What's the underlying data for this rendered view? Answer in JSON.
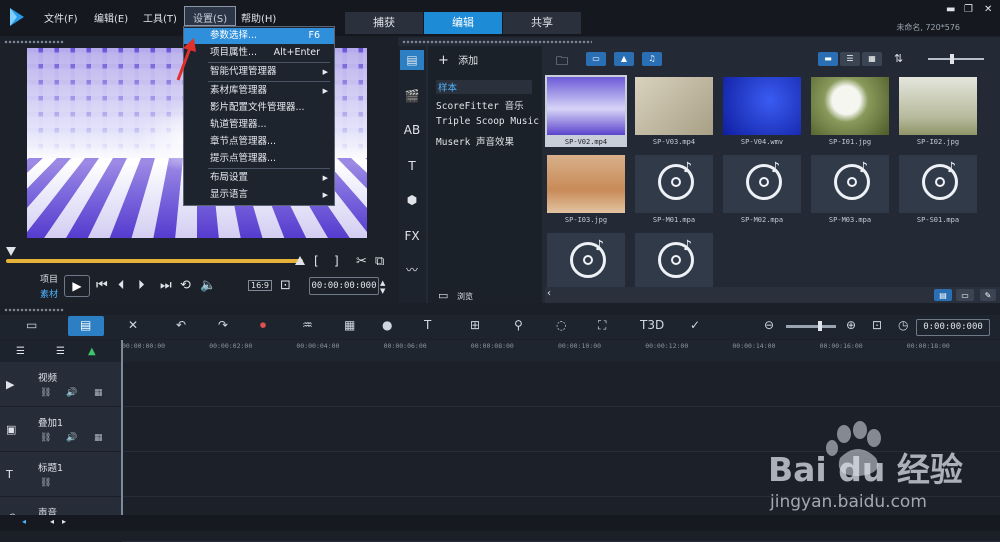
{
  "menubar": {
    "file": "文件(F)",
    "edit": "编辑(E)",
    "tools": "工具(T)",
    "settings": "设置(S)",
    "help": "帮助(H)"
  },
  "mode_tabs": [
    "捕获",
    "编辑",
    "共享"
  ],
  "project_info": "未命名, 720*576",
  "settings_menu": {
    "items": [
      {
        "label": "参数选择...",
        "shortcut": "F6"
      },
      {
        "label": "项目属性...",
        "shortcut": "Alt+Enter"
      },
      {
        "label": "智能代理管理器"
      },
      {
        "label": "素材库管理器"
      },
      {
        "label": "影片配置文件管理器..."
      },
      {
        "label": "轨道管理器..."
      },
      {
        "label": "章节点管理器..."
      },
      {
        "label": "提示点管理器..."
      },
      {
        "label": "布局设置"
      },
      {
        "label": "显示语言"
      }
    ]
  },
  "preview": {
    "label_project": "项目",
    "label_clip": "素材",
    "aspect_ratio": "16:9",
    "timecode": "00:00:00:000"
  },
  "library": {
    "add_label": "添加",
    "browse_label": "浏览",
    "folders": [
      "样本",
      "ScoreFitter 音乐",
      "Triple Scoop Music",
      "Muserk 声音效果"
    ],
    "thumbnails": [
      {
        "name": "SP-V02.mp4",
        "kind": "video",
        "selected": true
      },
      {
        "name": "SP-V03.mp4",
        "kind": "video"
      },
      {
        "name": "SP-V04.wmv",
        "kind": "video"
      },
      {
        "name": "SP-I01.jpg",
        "kind": "image"
      },
      {
        "name": "SP-I02.jpg",
        "kind": "image"
      },
      {
        "name": "SP-I03.jpg",
        "kind": "image"
      },
      {
        "name": "SP-M01.mpa",
        "kind": "audio"
      },
      {
        "name": "SP-M02.mpa",
        "kind": "audio"
      },
      {
        "name": "SP-M03.mpa",
        "kind": "audio"
      },
      {
        "name": "SP-S01.mpa",
        "kind": "audio"
      },
      {
        "name": "",
        "kind": "audio"
      },
      {
        "name": "",
        "kind": "audio"
      }
    ]
  },
  "timeline": {
    "timecode": "0:00:00:000",
    "ruler_labels": [
      "00:00:00:00",
      "00:00:02:00",
      "00:00:04:00",
      "00:00:06:00",
      "00:00:08:00",
      "00:00:10:00",
      "00:00:12:00",
      "00:00:14:00",
      "00:00:16:00",
      "00:00:18:00"
    ],
    "tracks": [
      {
        "name": "视频",
        "icon": "video-track-icon"
      },
      {
        "name": "叠加1",
        "icon": "overlay-track-icon"
      },
      {
        "name": "标题1",
        "icon": "title-track-icon"
      },
      {
        "name": "声音",
        "icon": "voice-track-icon"
      }
    ]
  },
  "watermark": {
    "brand": "Bai du 经验",
    "url": "jingyan.baidu.com"
  },
  "colors": {
    "accent": "#1e8bd6",
    "highlight": "#2f8fda",
    "scrub": "#e7b23a",
    "arrow": "#e0302a"
  }
}
